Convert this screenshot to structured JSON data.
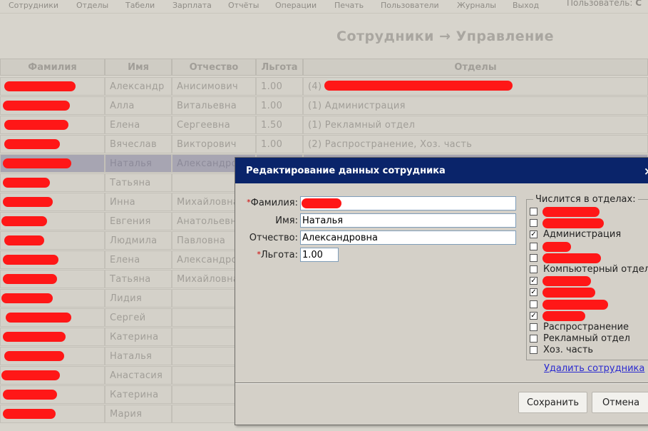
{
  "menu": {
    "items": [
      "Сотрудники",
      "Отделы",
      "Табели",
      "Зарплата",
      "Отчёты",
      "Операции",
      "Печать",
      "Пользователи",
      "Журналы",
      "Выход"
    ],
    "user_label": "Пользователь:",
    "user_name": "С"
  },
  "page": {
    "title": "Сотрудники → Управление"
  },
  "table": {
    "headers": [
      "Фамилия",
      "Имя",
      "Отчество",
      "Льгота",
      "Отделы"
    ],
    "rows": [
      {
        "first": "Александр",
        "middle": "Анисимович",
        "benefit": "1.00",
        "depts": "(4)"
      },
      {
        "first": "Алла",
        "middle": "Витальевна",
        "benefit": "1.00",
        "depts": "(1) Администрация"
      },
      {
        "first": "Елена",
        "middle": "Сергеевна",
        "benefit": "1.50",
        "depts": "(1) Рекламный отдел"
      },
      {
        "first": "Вячеслав",
        "middle": "Викторович",
        "benefit": "1.00",
        "depts": "(2) Распространение, Хоз. часть"
      },
      {
        "first": "Наталья",
        "middle": "Александровна",
        "benefit": "",
        "depts": ""
      },
      {
        "first": "Татьяна",
        "middle": "",
        "benefit": "",
        "depts": ""
      },
      {
        "first": "Инна",
        "middle": "Михайловна",
        "benefit": "",
        "depts": ""
      },
      {
        "first": "Евгения",
        "middle": "Анатольевна",
        "benefit": "",
        "depts": ""
      },
      {
        "first": "Людмила",
        "middle": "Павловна",
        "benefit": "",
        "depts": ""
      },
      {
        "first": "Елена",
        "middle": "Александровна",
        "benefit": "",
        "depts": ""
      },
      {
        "first": "Татьяна",
        "middle": "Михайловна",
        "benefit": "",
        "depts": ""
      },
      {
        "first": "Лидия",
        "middle": "",
        "benefit": "",
        "depts": ""
      },
      {
        "first": "Сергей",
        "middle": "",
        "benefit": "",
        "depts": ""
      },
      {
        "first": "Катерина",
        "middle": "",
        "benefit": "",
        "depts": ""
      },
      {
        "first": "Наталья",
        "middle": "",
        "benefit": "",
        "depts": ""
      },
      {
        "first": "Анастасия",
        "middle": "",
        "benefit": "",
        "depts": ""
      },
      {
        "first": "Катерина",
        "middle": "",
        "benefit": "",
        "depts": ""
      },
      {
        "first": "Мария",
        "middle": "",
        "benefit": "",
        "depts": ""
      }
    ]
  },
  "dialog": {
    "title": "Редактирование данных сотрудника",
    "close_glyph": "×",
    "required_mark": "*",
    "fields": {
      "last_name": {
        "label": "Фамилия:",
        "value": ""
      },
      "first_name": {
        "label": "Имя:",
        "value": "Наталья"
      },
      "middle_name": {
        "label": "Отчество:",
        "value": "Александровна"
      },
      "benefit": {
        "label": "Льгота:",
        "value": "1.00"
      }
    },
    "departments_legend": "Числится в отделах:",
    "departments": [
      {
        "label": "",
        "checked": false
      },
      {
        "label": "",
        "checked": false
      },
      {
        "label": "Администрация",
        "checked": true
      },
      {
        "label": "",
        "checked": false
      },
      {
        "label": "",
        "checked": false
      },
      {
        "label": "Компьютерный отдел",
        "checked": false
      },
      {
        "label": "",
        "checked": true
      },
      {
        "label": "",
        "checked": true
      },
      {
        "label": "",
        "checked": false
      },
      {
        "label": "",
        "checked": true
      },
      {
        "label": "Распространение",
        "checked": false
      },
      {
        "label": "Рекламный отдел",
        "checked": false
      },
      {
        "label": "Хоз. часть",
        "checked": false
      }
    ],
    "delete_link": "Удалить сотрудника",
    "save_button": "Сохранить",
    "cancel_button": "Отмена"
  },
  "colors": {
    "redaction": "#ff1717",
    "titlebar": "#0a246a",
    "selected_row": "#a7a5b2"
  }
}
